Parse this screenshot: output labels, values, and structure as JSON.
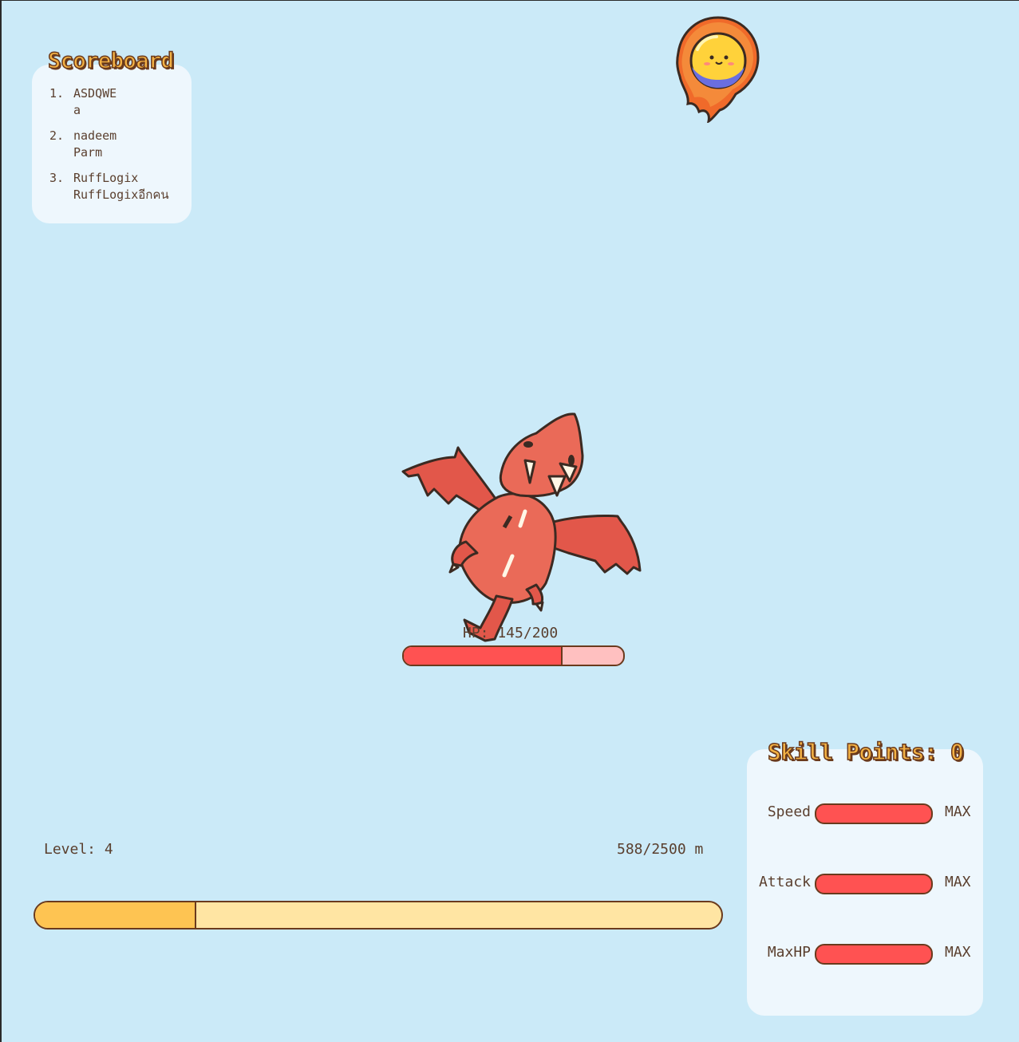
{
  "scoreboard": {
    "title": "Scoreboard",
    "entries": [
      {
        "rank": "1.",
        "line1": "ASDQWE",
        "line2": "a"
      },
      {
        "rank": "2.",
        "line1": "nadeem",
        "line2": "Parm"
      },
      {
        "rank": "3.",
        "line1": "RuffLogix",
        "line2": "RuffLogixอีกคน"
      }
    ]
  },
  "boss": {
    "hp_text": "HP: 145/200",
    "hp_current": 145,
    "hp_max": 200
  },
  "player": {
    "level_text": "Level: 4",
    "distance_text": "588/2500 m",
    "distance_current": 588,
    "distance_total": 2500
  },
  "skills": {
    "title": "Skill Points: 0",
    "items": [
      {
        "name": "Speed",
        "status": "MAX",
        "fill": 1.0
      },
      {
        "name": "Attack",
        "status": "MAX",
        "fill": 1.0
      },
      {
        "name": "MaxHP",
        "status": "MAX",
        "fill": 1.0
      }
    ]
  },
  "colors": {
    "background": "#cbeaf8",
    "hp_fill": "#ff5252",
    "hp_track": "#ffc0c0",
    "progress_fill": "#fec452",
    "progress_track": "#ffe5a3",
    "title_text": "#f4b244"
  },
  "icons": {
    "player": "fireball-icon",
    "enemy": "red-dragon-icon"
  }
}
